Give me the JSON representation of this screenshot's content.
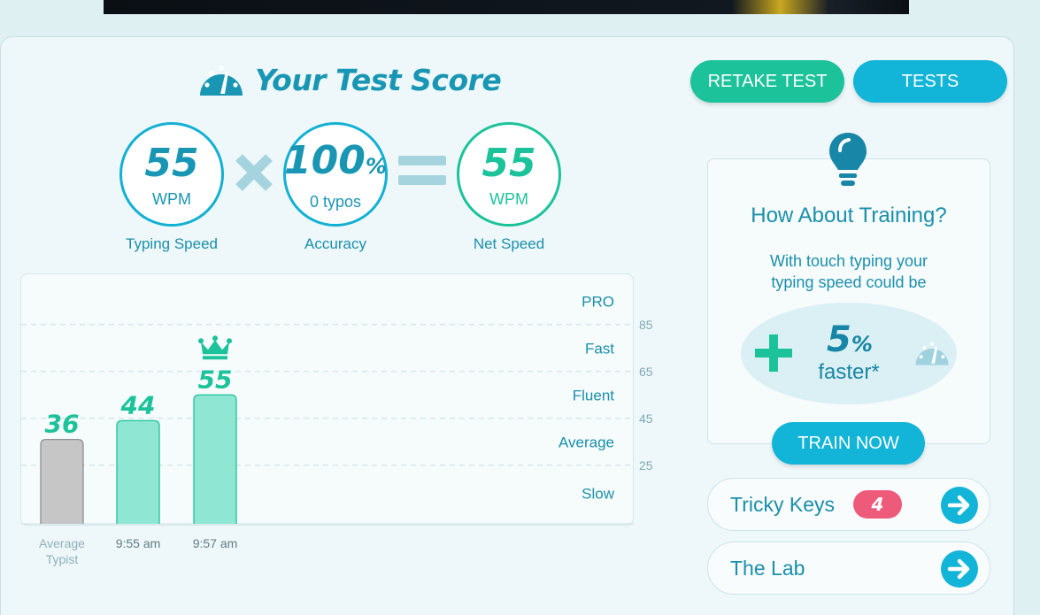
{
  "header": {
    "title": "Your Test Score",
    "retake_label": "RETAKE TEST",
    "tests_label": "TESTS"
  },
  "stats": {
    "speed": {
      "value": "55",
      "unit": "WPM",
      "label": "Typing Speed"
    },
    "accuracy": {
      "value": "100",
      "unit_symbol": "%",
      "sub": "0  typos",
      "label": "Accuracy"
    },
    "net": {
      "value": "55",
      "unit": "WPM",
      "label": "Net Speed"
    }
  },
  "chart_data": {
    "type": "bar",
    "categories": [
      "Average Typist",
      "9:55 am",
      "9:57 am"
    ],
    "values": [
      36,
      44,
      55
    ],
    "value_labels": [
      "36",
      "44",
      "55"
    ],
    "best_index": 2,
    "ylim": [
      0,
      100
    ],
    "y_ticks": [
      85,
      65,
      45,
      25
    ],
    "y_tick_labels": [
      "85",
      "65",
      "45",
      "25"
    ],
    "zones": [
      {
        "label": "PRO",
        "center": 95
      },
      {
        "label": "Fast",
        "center": 75
      },
      {
        "label": "Fluent",
        "center": 55
      },
      {
        "label": "Average",
        "center": 35
      },
      {
        "label": "Slow",
        "center": 13
      }
    ],
    "bar_colors": [
      "#c6c6c6",
      "#8fe6d2",
      "#8fe6d2"
    ],
    "grid": true
  },
  "training": {
    "heading": "How About Training?",
    "body_line1": "With touch typing your",
    "body_line2": "typing speed could be",
    "percent": "5",
    "percent_symbol": "%",
    "faster": "faster*",
    "train_label": "TRAIN NOW"
  },
  "links": {
    "tricky_keys": {
      "label": "Tricky Keys",
      "count": "4"
    },
    "the_lab": {
      "label": "The Lab"
    }
  },
  "colors": {
    "primary": "#1996b4",
    "accent_green": "#1cc39a",
    "button_blue": "#12b4d8",
    "badge_red": "#ee5b7a"
  }
}
